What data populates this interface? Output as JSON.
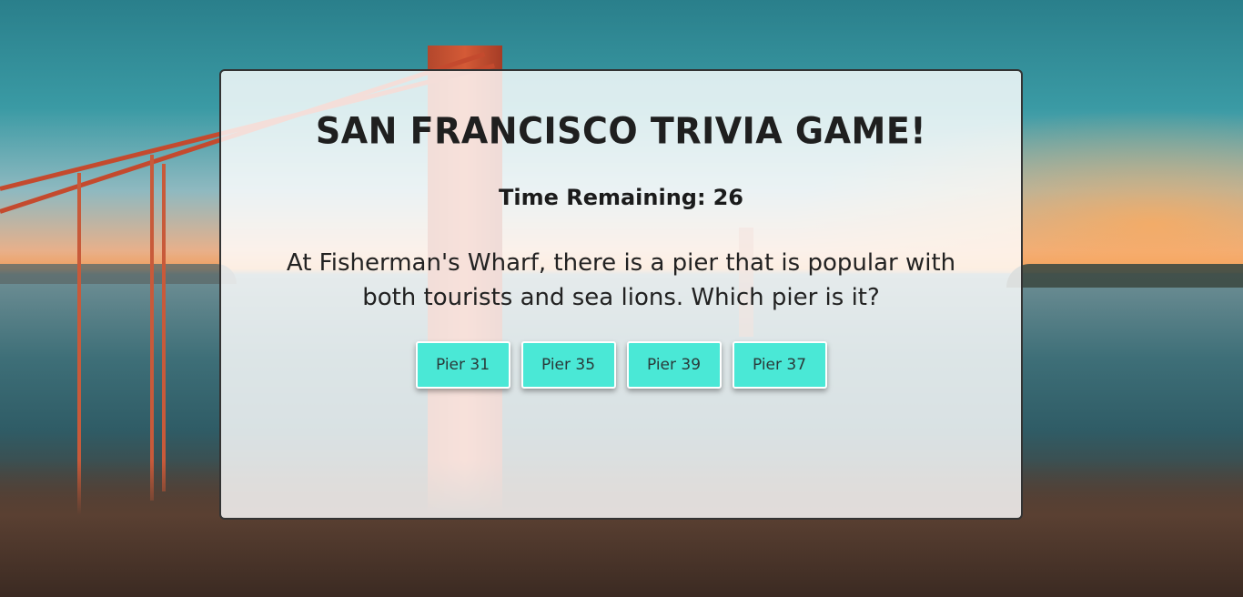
{
  "game": {
    "title": "San Francisco Trivia Game!",
    "timer_label": "Time Remaining:",
    "timer_value": "26",
    "question": "At Fisherman's Wharf, there is a pier that is popular with both tourists and sea lions. Which pier is it?",
    "answers": [
      "Pier 31",
      "Pier 35",
      "Pier 39",
      "Pier 37"
    ]
  },
  "colors": {
    "button": "#4ae8d6",
    "card": "#ffffffd1",
    "bridge": "#c44a2e"
  }
}
